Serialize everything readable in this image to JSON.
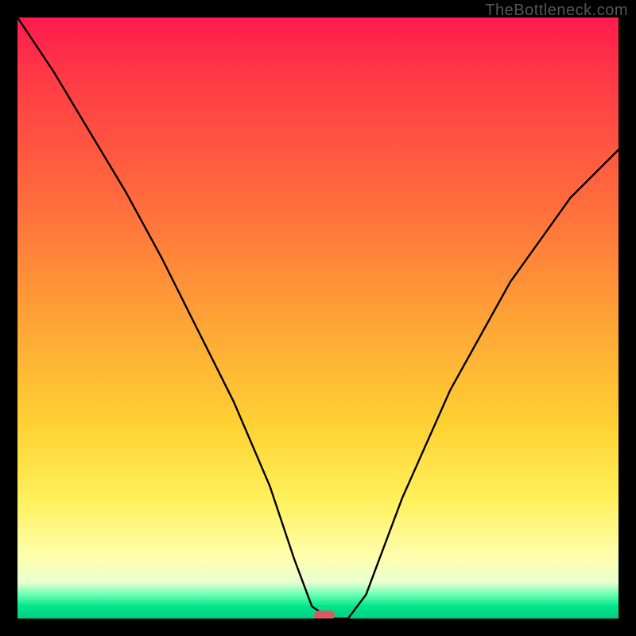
{
  "watermark": "TheBottleneck.com",
  "chart_data": {
    "type": "line",
    "title": "",
    "xlabel": "",
    "ylabel": "",
    "x_range": [
      0,
      100
    ],
    "y_range": [
      0,
      100
    ],
    "series": [
      {
        "name": "bottleneck-curve",
        "x": [
          0,
          6,
          12,
          18,
          24,
          30,
          36,
          42,
          46,
          49,
          52,
          55,
          58,
          64,
          72,
          82,
          92,
          100
        ],
        "y": [
          100,
          91,
          81,
          71,
          60,
          48,
          36,
          22,
          10,
          2,
          0,
          0,
          4,
          20,
          38,
          56,
          70,
          78
        ]
      }
    ],
    "annotations": [
      {
        "name": "optimal-marker",
        "x": 51,
        "y": 0.5,
        "shape": "pill",
        "color": "#d95a63"
      }
    ],
    "background_gradient": {
      "direction": "vertical",
      "stops": [
        {
          "pos": 0,
          "color": "#ff1a4d"
        },
        {
          "pos": 50,
          "color": "#ffa236"
        },
        {
          "pos": 80,
          "color": "#fff05a"
        },
        {
          "pos": 96,
          "color": "#6cffb5"
        },
        {
          "pos": 100,
          "color": "#00cc88"
        }
      ]
    }
  }
}
